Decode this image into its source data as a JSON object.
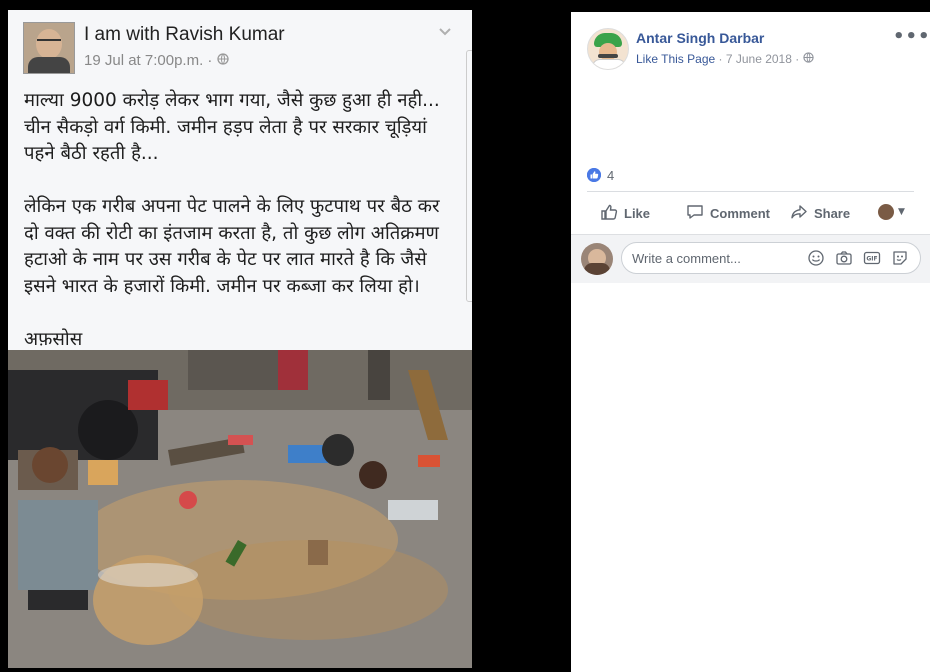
{
  "left_post": {
    "author": "I am with Ravish Kumar",
    "timestamp": "19 Jul at 7:00p.m. · ",
    "text": "माल्या 9000 करोड़ लेकर भाग गया, जैसे कुछ हुआ ही नही...\nचीन सैकड़ो वर्ग किमी. जमीन हड़प लेता है पर सरकार चूड़ियां\nपहने बैठी रहती है...\n\nलेकिन एक गरीब अपना पेट पालने के लिए फुटपाथ पर बैठ कर\nदो वक्त की रोटी का इंतजाम करता है, तो कुछ लोग अतिक्रमण\nहटाओ के नाम पर उस गरीब के पेट पर लात मारते है कि जैसे\nइसने भारत के हजारों किमी. जमीन पर कब्जा कर लिया हो।\n\nअफ़सोस"
  },
  "fb": {
    "page_name": "Antar Singh Darbar",
    "like_page": "Like This Page",
    "date": " · 7 June 2018 · ",
    "more": "•••",
    "reaction_count": "4",
    "actions": {
      "like": "Like",
      "comment": "Comment",
      "share": "Share"
    },
    "comment_placeholder": "Write a comment..."
  },
  "icons": [
    "globe-icon",
    "like-icon",
    "comment-icon",
    "share-icon",
    "emoji-icon",
    "camera-icon",
    "gif-icon",
    "sticker-icon"
  ]
}
